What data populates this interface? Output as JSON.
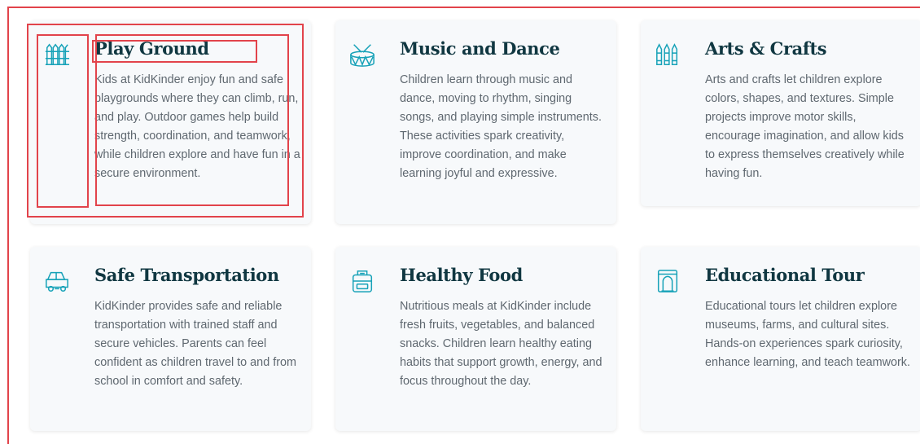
{
  "colors": {
    "accent": "#17a2b8",
    "title": "#103741",
    "text": "#5f6870",
    "card_bg": "#f7f9fb",
    "highlight": "#e2434b"
  },
  "cards": [
    {
      "icon": "fence-icon",
      "title": "Play Ground",
      "description": "Kids at KidKinder enjoy fun and safe playgrounds where they can climb, run, and play. Outdoor games help build strength, coordination, and teamwork, while children explore and have fun in a secure environment."
    },
    {
      "icon": "drum-icon",
      "title": "Music and Dance",
      "description": "Children learn through music and dance, moving to rhythm, singing songs, and playing simple instruments. These activities spark creativity, improve coordination, and make learning joyful and expressive."
    },
    {
      "icon": "crayons-icon",
      "title": "Arts & Crafts",
      "description": "Arts and crafts let children explore colors, shapes, and textures. Simple projects improve motor skills, encourage imagination, and allow kids to express themselves creatively while having fun."
    },
    {
      "icon": "school-bus-icon",
      "title": "Safe Transportation",
      "description": "KidKinder provides safe and reliable transportation with trained staff and secure vehicles. Parents can feel confident as children travel to and from school in comfort and safety."
    },
    {
      "icon": "lunchbox-icon",
      "title": "Healthy Food",
      "description": "Nutritious meals at KidKinder include fresh fruits, vegetables, and balanced snacks. Children learn healthy eating habits that support growth, energy, and focus throughout the day."
    },
    {
      "icon": "tour-book-icon",
      "title": "Educational Tour",
      "description": "Educational tours let children explore museums, farms, and cultural sites. Hands-on experiences spark curiosity, enhance learning, and teach teamwork."
    }
  ]
}
